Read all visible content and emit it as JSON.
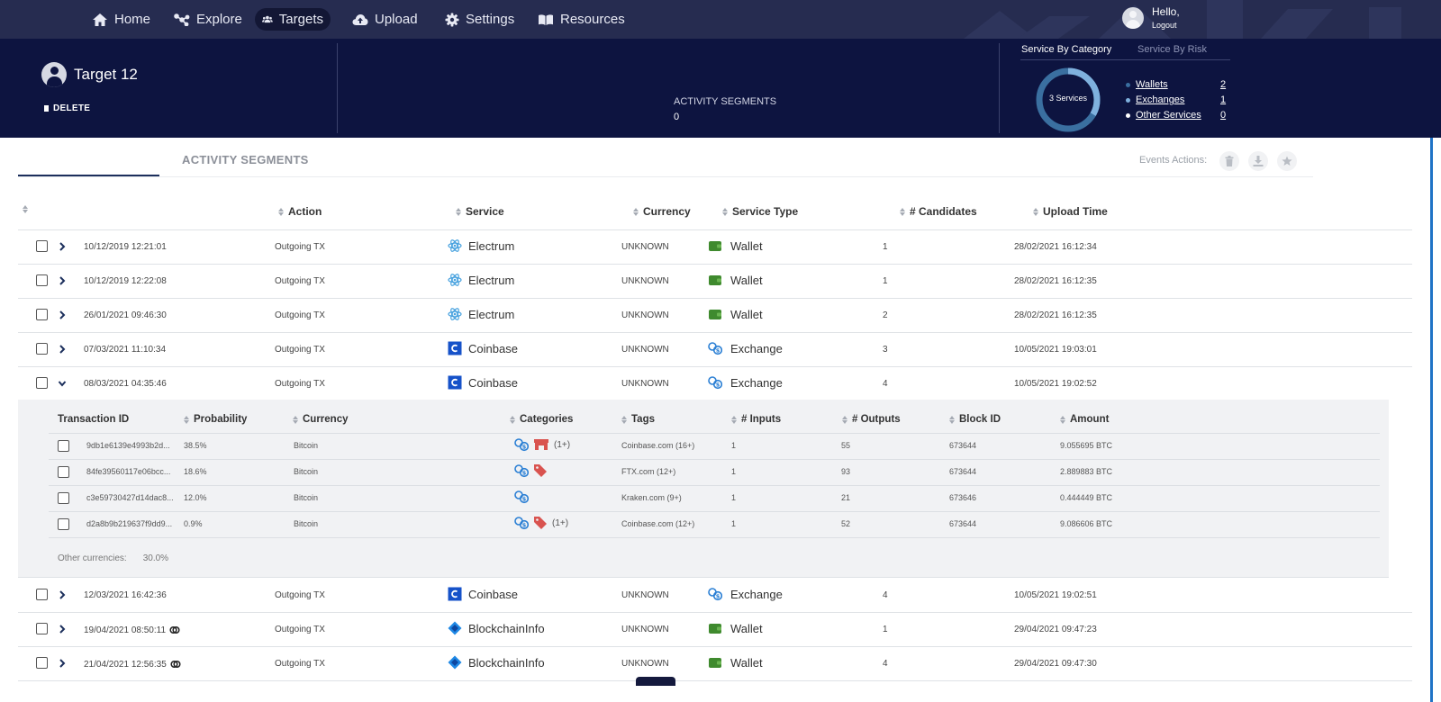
{
  "nav": {
    "items": [
      {
        "label": "Home",
        "icon": "home-icon"
      },
      {
        "label": "Explore",
        "icon": "explore-icon"
      },
      {
        "label": "Targets",
        "icon": "users-icon",
        "active": true
      },
      {
        "label": "Upload",
        "icon": "cloud-upload-icon"
      },
      {
        "label": "Settings",
        "icon": "gear-icon"
      },
      {
        "label": "Resources",
        "icon": "book-icon"
      }
    ],
    "user": {
      "greeting": "Hello,",
      "logout": "Logout"
    }
  },
  "target": {
    "name": "Target 12",
    "delete_label": "DELETE",
    "segments_label": "ACTIVITY SEGMENTS",
    "segments_count": "0"
  },
  "services_panel": {
    "tabs": [
      "Service By Category",
      "Service By Risk"
    ],
    "active_tab": "Service By Category",
    "donut_label": "3 Services",
    "legend": [
      {
        "name": "Wallets",
        "count": "2",
        "color": "#3a6fa0"
      },
      {
        "name": "Exchanges",
        "count": "1",
        "color": "#7fb1de"
      },
      {
        "name": "Other Services",
        "count": "0",
        "color": "#ffffff"
      }
    ]
  },
  "section": {
    "title": "ACTIVITY SEGMENTS",
    "events_label": "Events Actions:"
  },
  "table": {
    "columns": [
      "Action",
      "Service",
      "Currency",
      "Service Type",
      "# Candidates",
      "Upload Time"
    ],
    "rows": [
      {
        "date": "10/12/2019 12:21:01",
        "action": "Outgoing TX",
        "service": "Electrum",
        "currency": "UNKNOWN",
        "service_type": "Wallet",
        "candidates": "1",
        "upload": "28/02/2021 16:12:34"
      },
      {
        "date": "10/12/2019 12:22:08",
        "action": "Outgoing TX",
        "service": "Electrum",
        "currency": "UNKNOWN",
        "service_type": "Wallet",
        "candidates": "1",
        "upload": "28/02/2021 16:12:35"
      },
      {
        "date": "26/01/2021 09:46:30",
        "action": "Outgoing TX",
        "service": "Electrum",
        "currency": "UNKNOWN",
        "service_type": "Wallet",
        "candidates": "2",
        "upload": "28/02/2021 16:12:35"
      },
      {
        "date": "07/03/2021 11:10:34",
        "action": "Outgoing TX",
        "service": "Coinbase",
        "currency": "UNKNOWN",
        "service_type": "Exchange",
        "candidates": "3",
        "upload": "10/05/2021 19:03:01"
      },
      {
        "date": "08/03/2021 04:35:46",
        "action": "Outgoing TX",
        "service": "Coinbase",
        "currency": "UNKNOWN",
        "service_type": "Exchange",
        "candidates": "4",
        "upload": "10/05/2021 19:02:52"
      },
      {
        "date": "12/03/2021 16:42:36",
        "action": "Outgoing TX",
        "service": "Coinbase",
        "currency": "UNKNOWN",
        "service_type": "Exchange",
        "candidates": "4",
        "upload": "10/05/2021 19:02:51"
      },
      {
        "date": "19/04/2021 08:50:11",
        "action": "Outgoing TX",
        "service": "BlockchainInfo",
        "currency": "UNKNOWN",
        "service_type": "Wallet",
        "candidates": "1",
        "upload": "29/04/2021 09:47:23"
      },
      {
        "date": "21/04/2021 12:56:35",
        "action": "Outgoing TX",
        "service": "BlockchainInfo",
        "currency": "UNKNOWN",
        "service_type": "Wallet",
        "candidates": "4",
        "upload": "29/04/2021 09:47:30"
      }
    ]
  },
  "candidates": {
    "columns": [
      "Transaction ID",
      "Probability",
      "Currency",
      "Categories",
      "Tags",
      "# Inputs",
      "# Outputs",
      "Block ID",
      "Amount"
    ],
    "rows": [
      {
        "txid": "9db1e6139e4993b2d...",
        "prob": "38.5%",
        "currency": "Bitcoin",
        "cats_extra": "(1+)",
        "tags": "Coinbase.com (16+)",
        "inputs": "1",
        "outputs": "55",
        "block": "673644",
        "amount": "9.055695 BTC"
      },
      {
        "txid": "84fe39560117e06bcc...",
        "prob": "18.6%",
        "currency": "Bitcoin",
        "cats_extra": "",
        "tags": "FTX.com (12+)",
        "inputs": "1",
        "outputs": "93",
        "block": "673644",
        "amount": "2.889883 BTC"
      },
      {
        "txid": "c3e59730427d14dac8...",
        "prob": "12.0%",
        "currency": "Bitcoin",
        "cats_extra": "",
        "tags": "Kraken.com (9+)",
        "inputs": "1",
        "outputs": "21",
        "block": "673646",
        "amount": "0.444449 BTC"
      },
      {
        "txid": "d2a8b9b219637f9dd9...",
        "prob": "0.9%",
        "currency": "Bitcoin",
        "cats_extra": "(1+)",
        "tags": "Coinbase.com (12+)",
        "inputs": "1",
        "outputs": "52",
        "block": "673644",
        "amount": "9.086606 BTC"
      }
    ],
    "other_label": "Other currencies:",
    "other_value": "30.0%"
  }
}
